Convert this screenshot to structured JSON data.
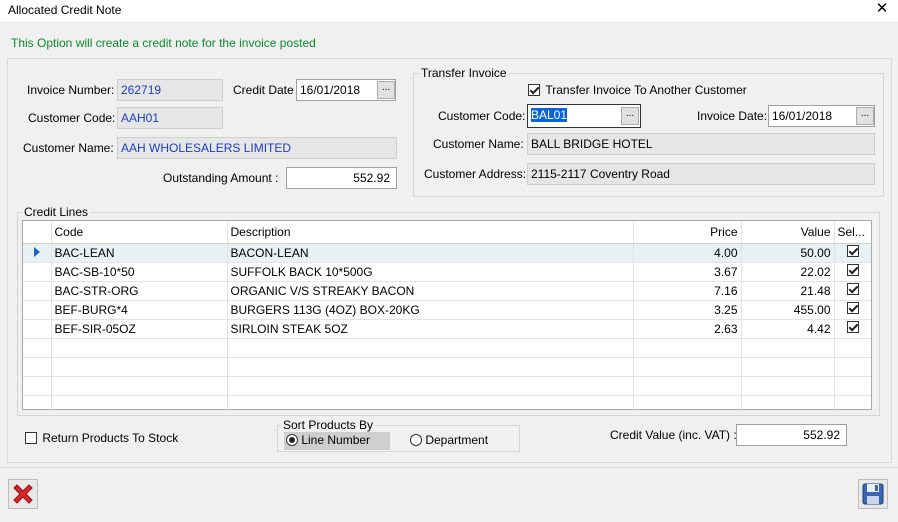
{
  "window": {
    "title": "Allocated Credit Note",
    "close_glyph": "✕"
  },
  "info_text": "This Option will create a credit note for the invoice posted",
  "invoice": {
    "number_label": "Invoice Number:",
    "number": "262719",
    "credit_date_label": "Credit Date",
    "credit_date": "16/01/2018",
    "customer_code_label": "Customer Code:",
    "customer_code": "AAH01",
    "customer_name_label": "Customer Name:",
    "customer_name": "AAH  WHOLESALERS LIMITED",
    "outstanding_label": "Outstanding Amount :",
    "outstanding": "552.92",
    "ellipsis": "..."
  },
  "transfer": {
    "group_title": "Transfer Invoice",
    "checkbox_label": "Transfer Invoice To Another Customer",
    "checked": true,
    "customer_code_label": "Customer Code:",
    "customer_code": "BAL01",
    "invoice_date_label": "Invoice Date:",
    "invoice_date": "16/01/2018",
    "customer_name_label": "Customer Name:",
    "customer_name": "BALL BRIDGE HOTEL",
    "customer_address_label": "Customer Address:",
    "customer_address": "2115-2117 Coventry Road"
  },
  "credit_lines": {
    "group_title": "Credit Lines",
    "columns": {
      "code": "Code",
      "description": "Description",
      "price": "Price",
      "value": "Value",
      "sel": "Sel..."
    },
    "rows": [
      {
        "code": "BAC-LEAN",
        "description": "BACON-LEAN",
        "price": "4.00",
        "value": "50.00",
        "sel": true
      },
      {
        "code": "BAC-SB-10*50",
        "description": "SUFFOLK BACK 10*500G",
        "price": "3.67",
        "value": "22.02",
        "sel": true
      },
      {
        "code": "BAC-STR-ORG",
        "description": "ORGANIC V/S STREAKY BACON",
        "price": "7.16",
        "value": "21.48",
        "sel": true
      },
      {
        "code": "BEF-BURG*4",
        "description": "BURGERS 113G (4OZ) BOX-20KG",
        "price": "3.25",
        "value": "455.00",
        "sel": true
      },
      {
        "code": "BEF-SIR-05OZ",
        "description": "SIRLOIN STEAK 5OZ",
        "price": "2.63",
        "value": "4.42",
        "sel": true
      }
    ]
  },
  "options": {
    "return_stock_label": "Return Products To Stock",
    "return_stock_checked": false,
    "sort_title": "Sort Products By",
    "sort_line": "Line Number",
    "sort_department": "Department",
    "sort_selected": "line",
    "credit_value_label": "Credit Value (inc. VAT) :",
    "credit_value": "552.92"
  },
  "icons": {
    "cancel": "cancel-x-icon",
    "save": "save-disk-icon"
  },
  "colors": {
    "info_green": "#0a8a2e",
    "field_blue": "#1a3fc2",
    "cancel_red": "#d9262c",
    "save_blue": "#3b66b0"
  }
}
